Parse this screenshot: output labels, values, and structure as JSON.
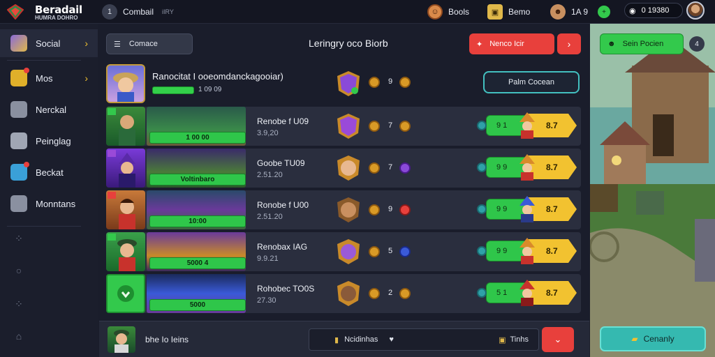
{
  "topbar": {
    "logo_title": "Beradail",
    "logo_sub": "HUMRA DOHRO",
    "nav_label": "Combail",
    "nav_extra": "iIRY",
    "item1": "Bools",
    "item2": "Bemo",
    "item3_value": "1A 9",
    "coins": "0 19380"
  },
  "sidebar": {
    "items": [
      {
        "label": "Social",
        "icon": "gem-icon"
      },
      {
        "label": "Mos",
        "icon": "treasure-icon"
      },
      {
        "label": "Nerckal",
        "icon": "scroll-icon"
      },
      {
        "label": "Peinglag",
        "icon": "book-icon"
      },
      {
        "label": "Beckat",
        "icon": "card-icon"
      },
      {
        "label": "Monntans",
        "icon": "mountain-icon"
      }
    ]
  },
  "main": {
    "left_button": "Comace",
    "title": "Leringry oco Biorb",
    "red_button": "Nenco Icir",
    "hero": {
      "title": "Ranocitat I ooeomdanckagooiar)",
      "progress_text": "1 09 09",
      "coin1": "9",
      "outline_button": "Palm Cocean"
    },
    "rows": [
      {
        "bar": "1 00 00",
        "name": "Renobe f U09",
        "sub": "3.9,20",
        "coin": "7",
        "pill": "9 1",
        "score": "8.7"
      },
      {
        "bar": "Voltinbaro",
        "name": "Goobe TU09",
        "sub": "2.51.20",
        "coin": "7",
        "pill": "9 9",
        "score": "8.7"
      },
      {
        "bar": "10:00",
        "name": "Ronobe f U00",
        "sub": "2.51.20",
        "coin": "9",
        "pill": "9 9",
        "score": "8.7"
      },
      {
        "bar": "5000 4",
        "name": "Renobax IAG",
        "sub": "9.9.21",
        "coin": "5",
        "pill": "9 9",
        "score": "8.7"
      },
      {
        "bar": "5000",
        "name": "Rohobec TO0S",
        "sub": "27.30",
        "coin": "2",
        "pill": "5 1",
        "score": "8.7"
      }
    ]
  },
  "bottom": {
    "text": "bhe Io Ieins",
    "field": "Ncidinhas",
    "field_right": "Tinhs"
  },
  "right": {
    "green_button": "Sein Pocien",
    "round_button": "4",
    "teal_button": "Cenanly"
  },
  "colors": {
    "background": "#1a1d2b",
    "panel": "#2a2e3e",
    "green": "#33c94c",
    "red": "#e8403c",
    "teal": "#35b9b0",
    "gold": "#f2c230"
  }
}
